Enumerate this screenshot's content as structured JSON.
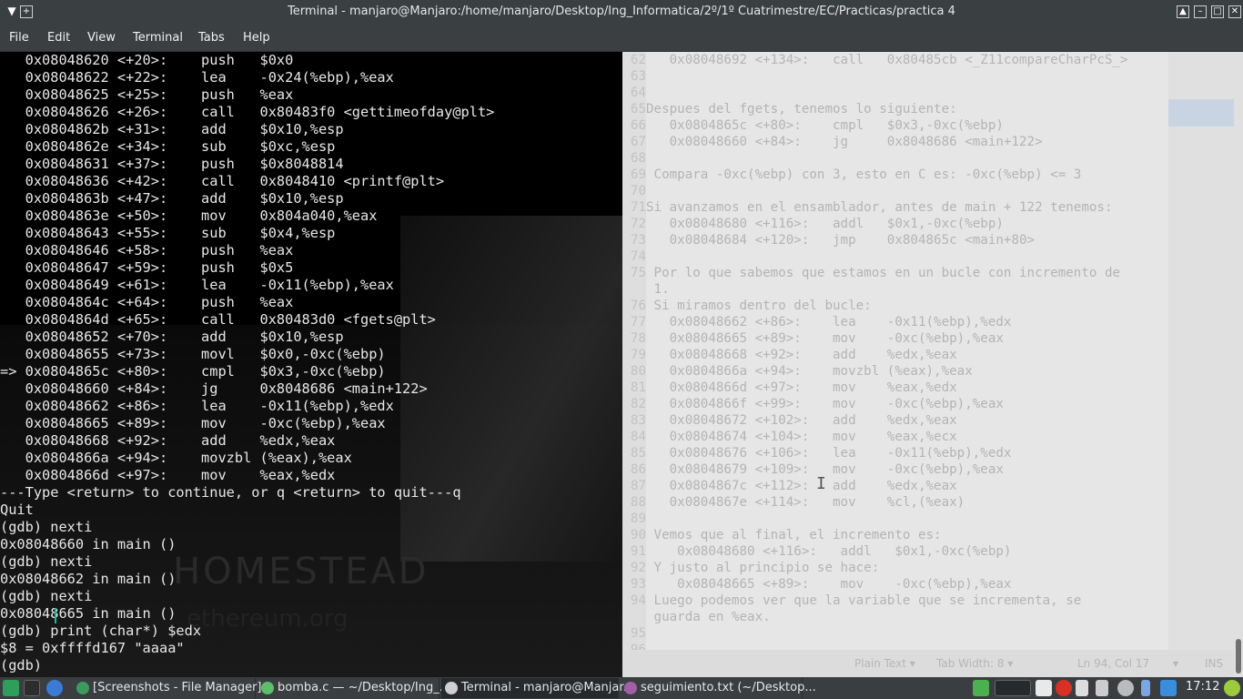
{
  "window": {
    "title": "Terminal - manjaro@Manjaro:/home/manjaro/Desktop/Ing_Informatica/2º/1º Cuatrimestre/EC/Practicas/practica 4"
  },
  "menubar": {
    "items": [
      "File",
      "Edit",
      "View",
      "Terminal",
      "Tabs",
      "Help"
    ]
  },
  "terminal": {
    "lines": [
      "   0x08048620 <+20>:    push   $0x0",
      "   0x08048622 <+22>:    lea    -0x24(%ebp),%eax",
      "   0x08048625 <+25>:    push   %eax",
      "   0x08048626 <+26>:    call   0x80483f0 <gettimeofday@plt>",
      "   0x0804862b <+31>:    add    $0x10,%esp",
      "   0x0804862e <+34>:    sub    $0xc,%esp",
      "   0x08048631 <+37>:    push   $0x8048814",
      "   0x08048636 <+42>:    call   0x8048410 <printf@plt>",
      "   0x0804863b <+47>:    add    $0x10,%esp",
      "   0x0804863e <+50>:    mov    0x804a040,%eax",
      "   0x08048643 <+55>:    sub    $0x4,%esp",
      "   0x08048646 <+58>:    push   %eax",
      "   0x08048647 <+59>:    push   $0x5",
      "   0x08048649 <+61>:    lea    -0x11(%ebp),%eax",
      "   0x0804864c <+64>:    push   %eax",
      "   0x0804864d <+65>:    call   0x80483d0 <fgets@plt>",
      "   0x08048652 <+70>:    add    $0x10,%esp",
      "   0x08048655 <+73>:    movl   $0x0,-0xc(%ebp)",
      "=> 0x0804865c <+80>:    cmpl   $0x3,-0xc(%ebp)",
      "   0x08048660 <+84>:    jg     0x8048686 <main+122>",
      "   0x08048662 <+86>:    lea    -0x11(%ebp),%edx",
      "   0x08048665 <+89>:    mov    -0xc(%ebp),%eax",
      "   0x08048668 <+92>:    add    %edx,%eax",
      "   0x0804866a <+94>:    movzbl (%eax),%eax",
      "   0x0804866d <+97>:    mov    %eax,%edx",
      "---Type <return> to continue, or q <return> to quit---q",
      "Quit",
      "(gdb) nexti",
      "0x08048660 in main ()",
      "(gdb) nexti",
      "0x08048662 in main ()",
      "(gdb) nexti",
      "0x08048665 in main ()",
      "(gdb) print (char*) $edx",
      "$8 = 0xffffd167 \"aaaa\"",
      "(gdb) "
    ],
    "wallpaper_text_1": "HOMESTEAD",
    "wallpaper_text_2": "ethereum.org"
  },
  "editor": {
    "lines": [
      {
        "n": "62",
        "t": "   0x08048692 <+134>:   call   0x80485cb <_Z11compareCharPcS_>"
      },
      {
        "n": "63",
        "t": ""
      },
      {
        "n": "64",
        "t": ""
      },
      {
        "n": "65",
        "t": "Despues del fgets, tenemos lo siguiente:"
      },
      {
        "n": "66",
        "t": "   0x0804865c <+80>:    cmpl   $0x3,-0xc(%ebp)"
      },
      {
        "n": "67",
        "t": "   0x08048660 <+84>:    jg     0x8048686 <main+122>"
      },
      {
        "n": "68",
        "t": ""
      },
      {
        "n": "69",
        "t": " Compara -0xc(%ebp) con 3, esto en C es: -0xc(%ebp) <= 3"
      },
      {
        "n": "70",
        "t": ""
      },
      {
        "n": "71",
        "t": "Si avanzamos en el ensamblador, antes de main + 122 tenemos:"
      },
      {
        "n": "72",
        "t": "   0x08048680 <+116>:   addl   $0x1,-0xc(%ebp)"
      },
      {
        "n": "73",
        "t": "   0x08048684 <+120>:   jmp    0x804865c <main+80>"
      },
      {
        "n": "74",
        "t": ""
      },
      {
        "n": "75",
        "t": " Por lo que sabemos que estamos en un bucle con incremento de"
      },
      {
        "n": "",
        "t": " 1."
      },
      {
        "n": "76",
        "t": " Si miramos dentro del bucle:"
      },
      {
        "n": "77",
        "t": "   0x08048662 <+86>:    lea    -0x11(%ebp),%edx"
      },
      {
        "n": "78",
        "t": "   0x08048665 <+89>:    mov    -0xc(%ebp),%eax"
      },
      {
        "n": "79",
        "t": "   0x08048668 <+92>:    add    %edx,%eax"
      },
      {
        "n": "80",
        "t": "   0x0804866a <+94>:    movzbl (%eax),%eax"
      },
      {
        "n": "81",
        "t": "   0x0804866d <+97>:    mov    %eax,%edx"
      },
      {
        "n": "82",
        "t": "   0x0804866f <+99>:    mov    -0xc(%ebp),%eax"
      },
      {
        "n": "83",
        "t": "   0x08048672 <+102>:   add    %edx,%eax"
      },
      {
        "n": "84",
        "t": "   0x08048674 <+104>:   mov    %eax,%ecx"
      },
      {
        "n": "85",
        "t": "   0x08048676 <+106>:   lea    -0x11(%ebp),%edx"
      },
      {
        "n": "86",
        "t": "   0x08048679 <+109>:   mov    -0xc(%ebp),%eax"
      },
      {
        "n": "87",
        "t": "   0x0804867c <+112>:   add    %edx,%eax"
      },
      {
        "n": "88",
        "t": "   0x0804867e <+114>:   mov    %cl,(%eax)"
      },
      {
        "n": "89",
        "t": ""
      },
      {
        "n": "90",
        "t": " Vemos que al final, el incremento es:"
      },
      {
        "n": "91",
        "t": "    0x08048680 <+116>:   addl   $0x1,-0xc(%ebp)"
      },
      {
        "n": "92",
        "t": " Y justo al principio se hace:"
      },
      {
        "n": "93",
        "t": "    0x08048665 <+89>:    mov    -0xc(%ebp),%eax"
      },
      {
        "n": "94",
        "t": " Luego podemos ver que la variable que se incrementa, se"
      },
      {
        "n": "",
        "t": " guarda en %eax."
      },
      {
        "n": "95",
        "t": ""
      },
      {
        "n": "96",
        "t": ""
      }
    ],
    "status": {
      "syntax": "Plain Text ▾",
      "tab": "Tab Width: 8 ▾",
      "position": "Ln 94, Col 17",
      "mode": "▾",
      "ins": "INS"
    }
  },
  "taskbar": {
    "tasks": [
      {
        "label": "[Screenshots - File Manager]",
        "icon_color": "#3c9a5f"
      },
      {
        "label": "bomba.c — ~/Desktop/Ing_...",
        "icon_color": "#5bbf6c"
      },
      {
        "label": "Terminal - manjaro@Manjar...",
        "icon_color": "#cfcfcf"
      },
      {
        "label": "seguimiento.txt (~/Desktop...",
        "icon_color": "#a05fa6"
      }
    ],
    "clock": "17:12",
    "colors": {
      "accent": "#1abc9c",
      "bar": "#3a3e40"
    }
  }
}
